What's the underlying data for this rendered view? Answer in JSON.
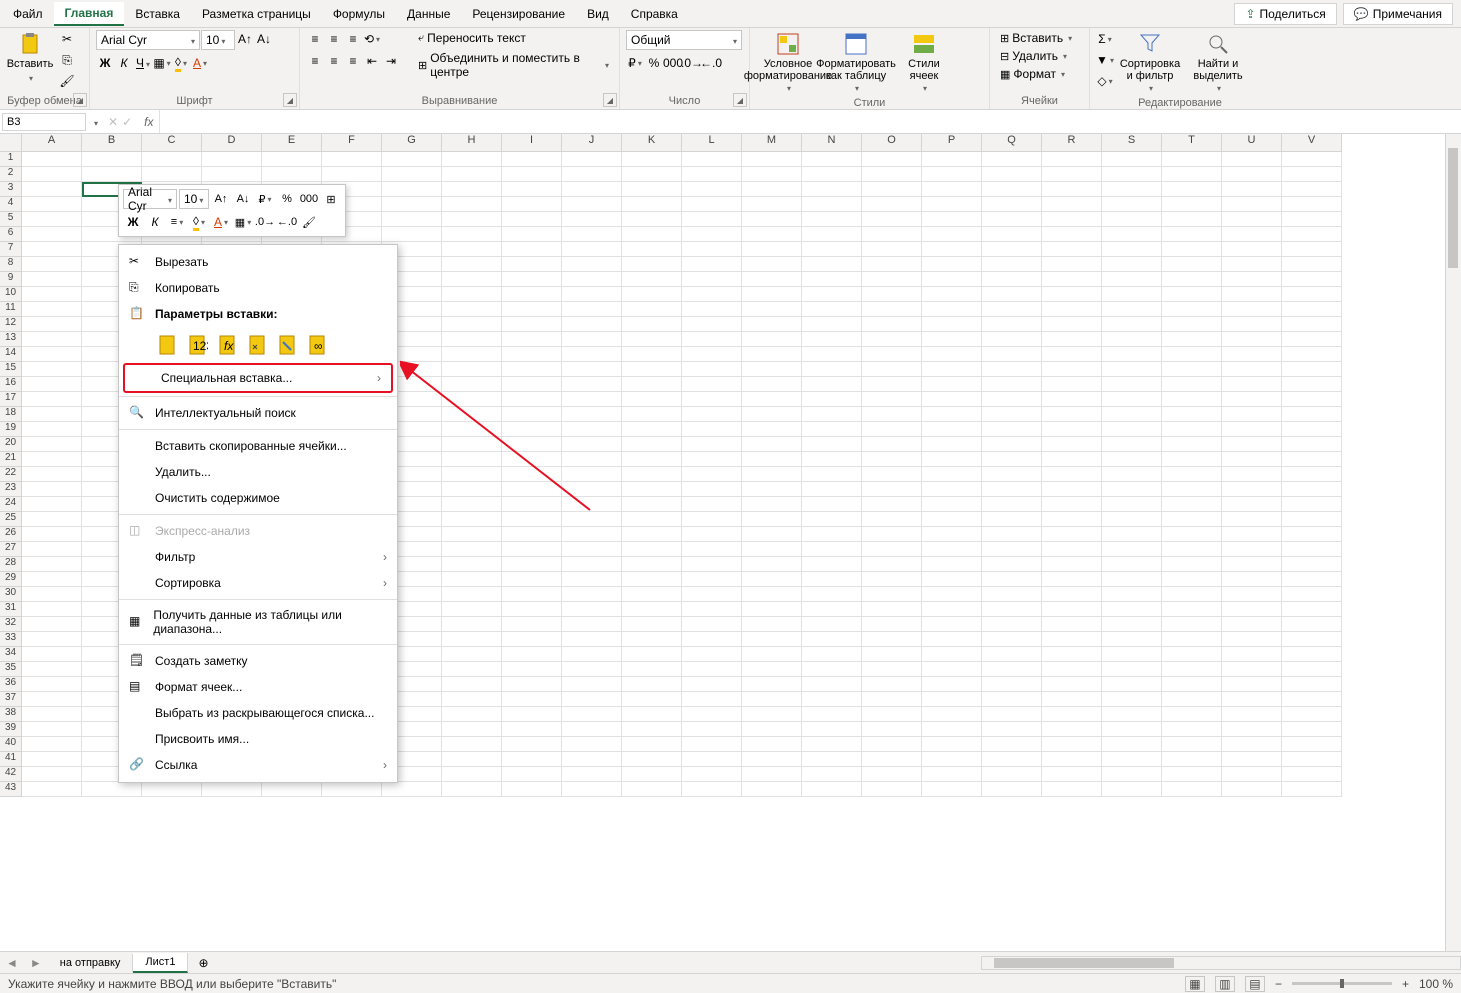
{
  "tabs": {
    "file": "Файл",
    "home": "Главная",
    "insert": "Вставка",
    "layout": "Разметка страницы",
    "formulas": "Формулы",
    "data": "Данные",
    "review": "Рецензирование",
    "view": "Вид",
    "help": "Справка"
  },
  "topright": {
    "share": "Поделиться",
    "comments": "Примечания"
  },
  "ribbon": {
    "clipboard": {
      "paste": "Вставить",
      "title": "Буфер обмена"
    },
    "font": {
      "name": "Arial Cyr",
      "size": "10",
      "title": "Шрифт"
    },
    "align": {
      "wrap": "Переносить текст",
      "merge": "Объединить и поместить в центре",
      "title": "Выравнивание"
    },
    "number": {
      "format": "Общий",
      "title": "Число"
    },
    "styles": {
      "cond": "Условное форматирование",
      "table": "Форматировать как таблицу",
      "cell": "Стили ячеек",
      "title": "Стили"
    },
    "cells": {
      "insert": "Вставить",
      "delete": "Удалить",
      "format": "Формат",
      "title": "Ячейки"
    },
    "editing": {
      "sort": "Сортировка и фильтр",
      "find": "Найти и выделить",
      "title": "Редактирование"
    }
  },
  "namebox": "B3",
  "minitoolbar": {
    "font": "Arial Cyr",
    "size": "10"
  },
  "ctx": {
    "cut": "Вырезать",
    "copy": "Копировать",
    "paste_opts": "Параметры вставки:",
    "paste_special": "Специальная вставка...",
    "smart_lookup": "Интеллектуальный поиск",
    "insert_copied": "Вставить скопированные ячейки...",
    "delete": "Удалить...",
    "clear": "Очистить содержимое",
    "quick_analysis": "Экспресс-анализ",
    "filter": "Фильтр",
    "sort": "Сортировка",
    "get_data": "Получить данные из таблицы или диапазона...",
    "note": "Создать заметку",
    "format_cells": "Формат ячеек...",
    "dropdown": "Выбрать из раскрывающегося списка...",
    "name": "Присвоить имя...",
    "link": "Ссылка"
  },
  "columns": [
    "A",
    "B",
    "C",
    "D",
    "E",
    "F",
    "G",
    "H",
    "I",
    "J",
    "K",
    "L",
    "M",
    "N",
    "O",
    "P",
    "Q",
    "R",
    "S",
    "T",
    "U",
    "V"
  ],
  "rowcount": 43,
  "sheets": {
    "s1": "на отправку",
    "s2": "Лист1"
  },
  "status": "Укажите ячейку и нажмите ВВОД или выберите \"Вставить\"",
  "zoom": "100 %"
}
